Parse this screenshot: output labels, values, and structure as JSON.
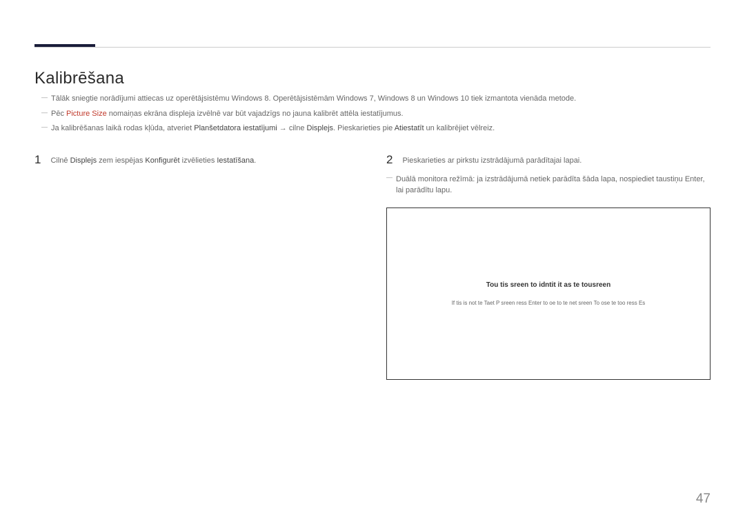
{
  "title": "Kalibrēšana",
  "intro": {
    "line1_pre": "Tālāk sniegtie norādījumi attiecas uz operētājsistēmu Windows 8. Operētājsistēmām Windows 7, Windows 8 un Windows 10 tiek izmantota vienāda metode.",
    "line2_pre": "Pēc ",
    "line2_picture": "Picture Size",
    "line2_post": " nomaiņas ekrāna displeja izvēlnē var būt vajadzīgs no jauna kalibrēt attēla iestatījumus.",
    "line3_pre": "Ja kalibrēšanas laikā rodas kļūda, atveriet ",
    "line3_b1": "Planšetdatora iestatījumi",
    "line3_mid1": " → cilne ",
    "line3_b2": "Displejs",
    "line3_mid2": ". Pieskarieties pie ",
    "line3_b3": "Atiestatīt",
    "line3_post": " un kalibrējiet vēlreiz."
  },
  "step1": {
    "num": "1",
    "pre": "Cilnē ",
    "b1": "Displejs",
    "mid1": " zem iespējas ",
    "b2": "Konfigurēt",
    "mid2": " izvēlieties ",
    "b3": "Iestatīšana",
    "post": "."
  },
  "step2": {
    "num": "2",
    "text": "Pieskarieties ar pirkstu izstrādājumā parādītajai lapai.",
    "note": "Duālā monitora režīmā: ja izstrādājumā netiek parādīta šāda lapa, nospiediet taustiņu Enter, lai parādītu lapu."
  },
  "screen": {
    "bold": "Tou tis sreen to idntit it as te tousreen",
    "small": "If tis is not te Taet P sreen ress Enter to oe to te net sreen To ose te too ress Es"
  },
  "pageNumber": "47"
}
